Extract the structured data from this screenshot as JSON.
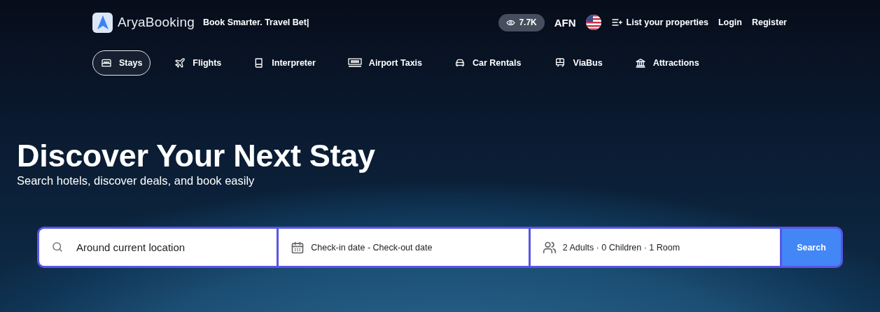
{
  "brand": {
    "name": "AryaBooking",
    "tagline": "Book Smarter. Travel Bet|"
  },
  "header": {
    "views": "7.7K",
    "currency": "AFN",
    "links": [
      {
        "label": "List your properties",
        "kind": "list"
      },
      {
        "label": "Login",
        "kind": "plain"
      },
      {
        "label": "Register",
        "kind": "plain"
      }
    ]
  },
  "nav": [
    {
      "label": "Stays",
      "kind": "bed",
      "selected": true
    },
    {
      "label": "Flights",
      "kind": "plane",
      "selected": false
    },
    {
      "label": "Interpreter",
      "kind": "book",
      "selected": false
    },
    {
      "label": "Airport Taxis",
      "kind": "taxi",
      "selected": false
    },
    {
      "label": "Car Rentals",
      "kind": "car",
      "selected": false
    },
    {
      "label": "ViaBus",
      "kind": "bus",
      "selected": false
    },
    {
      "label": "Attractions",
      "kind": "museum",
      "selected": false
    }
  ],
  "hero": {
    "title": "Discover Your Next Stay",
    "subtitle": "Search hotels, discover deals, and book easily"
  },
  "search": {
    "location": "Around current location",
    "dates": "Check-in date - Check-out date",
    "guests": "2 Adults · 0 Children · 1 Room",
    "button": "Search"
  }
}
